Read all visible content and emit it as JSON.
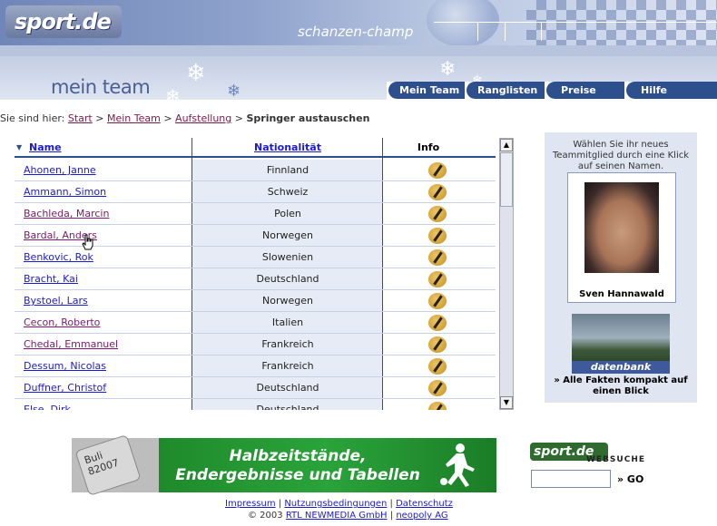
{
  "header": {
    "logo_text": "sport.de",
    "app_title": "schanzen-champ",
    "section_title": "mein team"
  },
  "nav": {
    "tabs": [
      "Mein Team",
      "Ranglisten",
      "Preise",
      "Hilfe"
    ]
  },
  "breadcrumb": {
    "prefix": "Sie sind hier:",
    "items": [
      "Start",
      "Mein Team",
      "Aufstellung"
    ],
    "current": "Springer austauschen",
    "separator": ">"
  },
  "table": {
    "columns": [
      "Name",
      "Nationalität",
      "Info"
    ],
    "rows": [
      {
        "name": "Ahonen, Janne",
        "nationality": "Finnland"
      },
      {
        "name": "Ammann, Simon",
        "nationality": "Schweiz"
      },
      {
        "name": "Bachleda, Marcin",
        "nationality": "Polen"
      },
      {
        "name": "Bardal, Anders",
        "nationality": "Norwegen"
      },
      {
        "name": "Benkovic, Rok",
        "nationality": "Slowenien"
      },
      {
        "name": "Bracht, Kai",
        "nationality": "Deutschland"
      },
      {
        "name": "Bystoel, Lars",
        "nationality": "Norwegen"
      },
      {
        "name": "Cecon, Roberto",
        "nationality": "Italien"
      },
      {
        "name": "Chedal, Emmanuel",
        "nationality": "Frankreich"
      },
      {
        "name": "Dessum, Nicolas",
        "nationality": "Frankreich"
      },
      {
        "name": "Duffner, Christof",
        "nationality": "Deutschland"
      },
      {
        "name": "Else, Dirk",
        "nationality": "Deutschland"
      }
    ]
  },
  "side_panel": {
    "instruction": "Wählen Sie ihr neues Teammitglied durch eine Klick auf seinen Namen.",
    "featured_name": "Sven Hannawald",
    "db_label": "datenbank",
    "db_text": "» Alle Fakten kompakt auf einen Blick"
  },
  "banner": {
    "phone_text": "Buli 82007",
    "text": "Halbzeitstände, Endergebnisse und Tabellen"
  },
  "search": {
    "logo_text": "sport.de",
    "caption": "WEBSUCHE",
    "go_label": "» GO",
    "placeholder": ""
  },
  "footer": {
    "links": [
      "Impressum",
      "Nutzungsbedingungen",
      "Datenschutz"
    ],
    "copyright_prefix": "© 2003",
    "company_links": [
      "RTL NEWMEDIA GmbH",
      "neopoly AG"
    ]
  },
  "colors": {
    "nav_tab": "#2e4f8e",
    "link": "#1b1bd0",
    "visited_link": "#7a1a6a",
    "panel_bg": "#dfe5f1"
  }
}
